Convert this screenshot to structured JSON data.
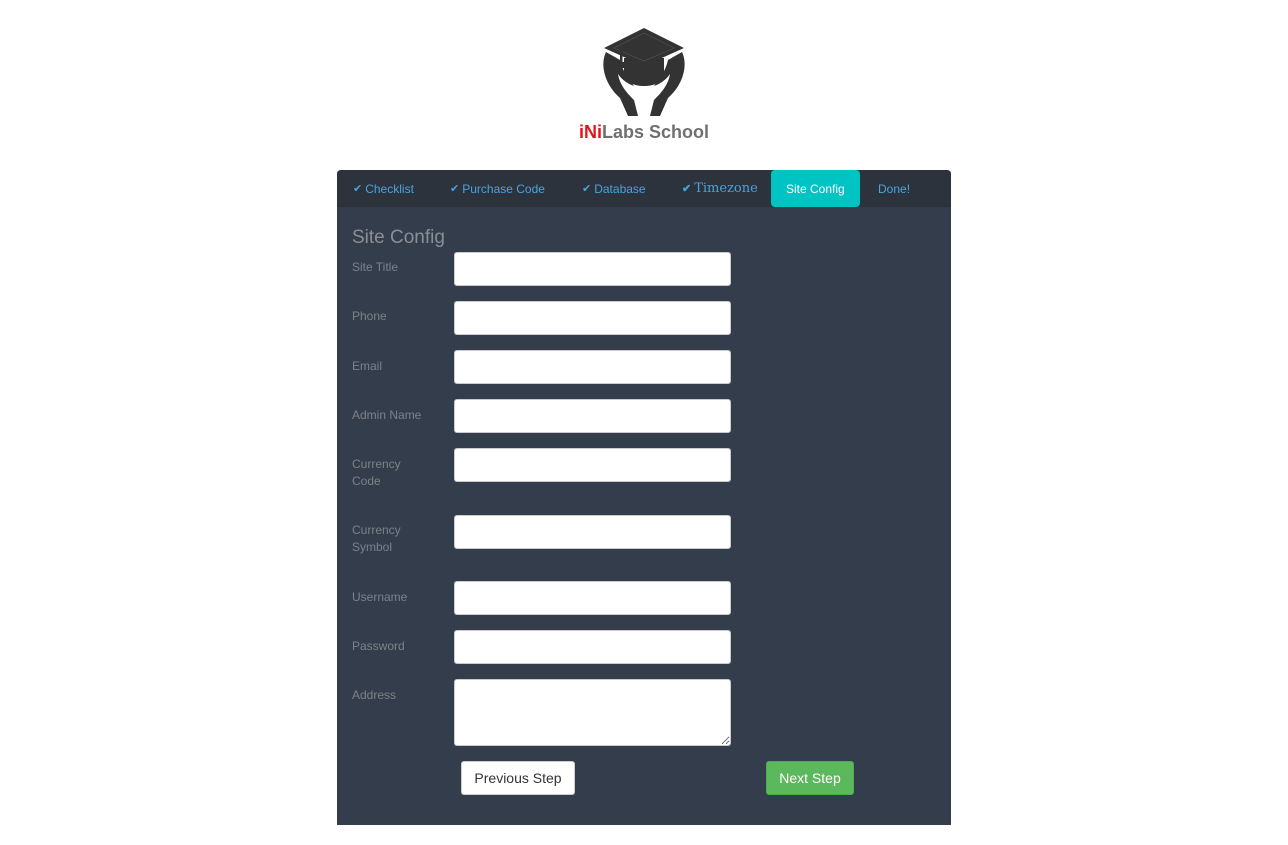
{
  "brand": {
    "prefix": "iNi",
    "suffix": "Labs School",
    "logo_icon": "graduation-cap-hands-icon"
  },
  "tabs": [
    {
      "label": "Checklist",
      "done": true
    },
    {
      "label": "Purchase Code",
      "done": true
    },
    {
      "label": "Database",
      "done": true
    },
    {
      "label": "Timezone",
      "done": true
    },
    {
      "label": "Site Config",
      "active": true
    },
    {
      "label": "Done!"
    }
  ],
  "check_glyph": "✔",
  "form": {
    "title": "Site Config",
    "fields": [
      {
        "label": "Site Title",
        "value": ""
      },
      {
        "label": "Phone",
        "value": ""
      },
      {
        "label": "Email",
        "value": ""
      },
      {
        "label": "Admin Name",
        "value": ""
      },
      {
        "label": "Currency Code",
        "value": ""
      },
      {
        "label": "Currency Symbol",
        "value": ""
      },
      {
        "label": "Username",
        "value": ""
      },
      {
        "label": "Password",
        "value": ""
      },
      {
        "label": "Address",
        "value": ""
      }
    ]
  },
  "buttons": {
    "previous": "Previous Step",
    "next": "Next Step"
  },
  "colors": {
    "panel": "#343d4b",
    "tab_bar": "#2c333d",
    "active_tab": "#00c4c4",
    "tab_text": "#4aa3df",
    "brand_red": "#e1151a",
    "next_button": "#5cb85c"
  }
}
